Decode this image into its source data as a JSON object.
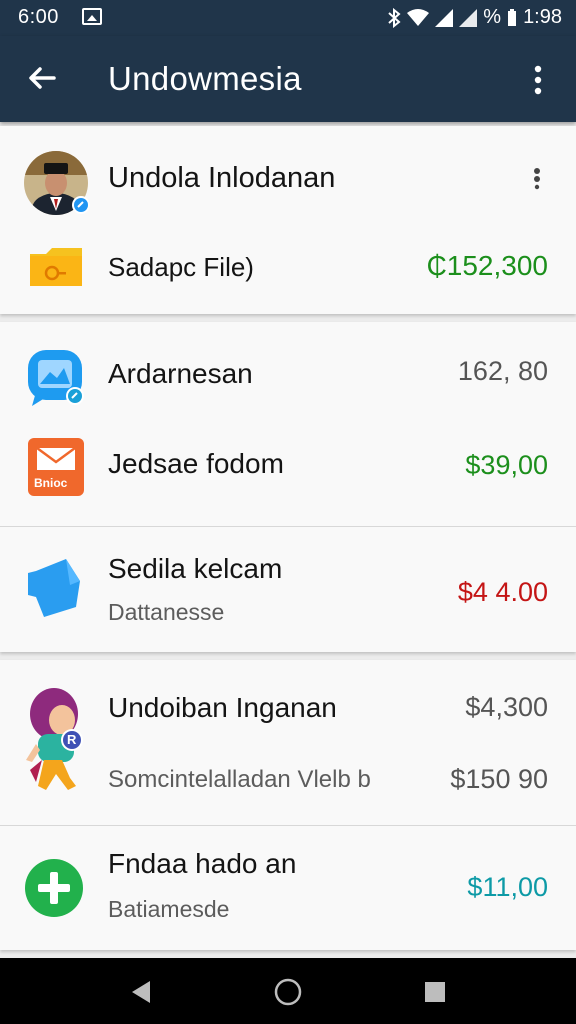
{
  "status_bar": {
    "time": "6:00",
    "battery_text": "%",
    "clock": "1:98"
  },
  "app_bar": {
    "title": "Undowmesia"
  },
  "profile": {
    "name": "Undola Inlodanan",
    "file_label": "Sadapc File)",
    "file_amount": "₵152,300"
  },
  "items": [
    {
      "label": "Ardarnesan",
      "amount": "162, 80",
      "icon": "messenger-icon"
    },
    {
      "label": "Jedsae fodom",
      "amount": "$39,00",
      "icon": "mail-icon",
      "icon_text": "Bnioc"
    },
    {
      "label": "Sedila kelcam",
      "sub": "Dattanesse",
      "amount": "$4 4.00",
      "icon": "tag-icon"
    },
    {
      "label": "Undoiban Inganan",
      "sub": "Somcintelalladan Vlelb b",
      "amount": "$4,300",
      "amount2": "$150 90",
      "icon": "character-avatar-icon",
      "badge": "R"
    },
    {
      "label": "Fndaa hado an",
      "sub": "Batiamesde",
      "amount": "$11,00",
      "icon": "add-circle-icon"
    }
  ],
  "colors": {
    "header": "#20354a",
    "amount_green": "#1c8f1c",
    "amount_red": "#c41515",
    "amount_teal": "#0d9aa6"
  }
}
